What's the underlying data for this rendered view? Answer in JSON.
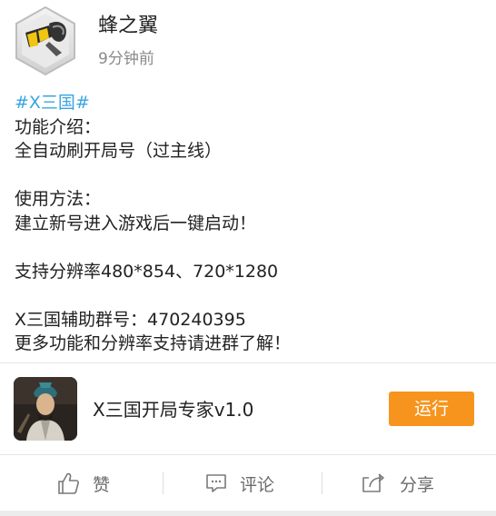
{
  "author": {
    "name": "蜂之翼",
    "time": "9分钟前",
    "avatar_icon": "bee-wing-logo-icon"
  },
  "post": {
    "hashtag": "#X三国#",
    "lines": [
      "功能介绍：",
      "全自动刷开局号（过主线）",
      "",
      "使用方法：",
      "建立新号进入游戏后一键启动！",
      "",
      "支持分辨率480*854、720*1280",
      "",
      "X三国辅助群号：470240395",
      "更多功能和分辨率支持请进群了解！"
    ]
  },
  "app_card": {
    "name": "X三国开局专家v1.0",
    "button_label": "运行",
    "icon": "warrior-portrait-icon",
    "button_color": "#f7941d"
  },
  "actions": {
    "like_label": "赞",
    "comment_label": "评论",
    "share_label": "分享",
    "like_icon": "thumbs-up-icon",
    "comment_icon": "comment-icon",
    "share_icon": "share-icon"
  },
  "colors": {
    "hashtag": "#3aa5e0",
    "text": "#222222",
    "muted": "#8a8a8a"
  }
}
